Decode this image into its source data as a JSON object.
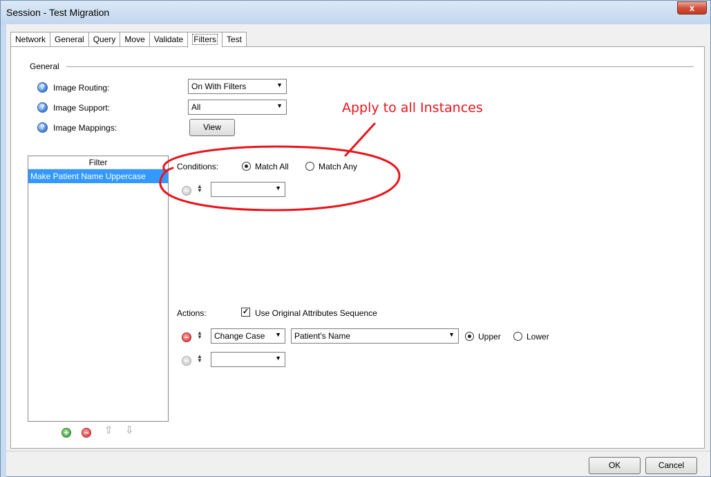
{
  "window": {
    "title": "Session - Test Migration",
    "close_label": "x"
  },
  "tabs": [
    {
      "label": "Network"
    },
    {
      "label": "General"
    },
    {
      "label": "Query"
    },
    {
      "label": "Move"
    },
    {
      "label": "Validate"
    },
    {
      "label": "Filters",
      "active": true
    },
    {
      "label": "Test"
    }
  ],
  "general": {
    "group_label": "General",
    "image_routing": {
      "label": "Image Routing:",
      "value": "On With Filters"
    },
    "image_support": {
      "label": "Image Support:",
      "value": "All"
    },
    "image_mappings": {
      "label": "Image Mappings:",
      "button": "View"
    }
  },
  "filter_list": {
    "header": "Filter",
    "items": [
      {
        "label": "Make Patient Name Uppercase",
        "selected": true
      }
    ]
  },
  "conditions": {
    "label": "Conditions:",
    "match_all": "Match All",
    "match_any": "Match Any",
    "selected": "Match All",
    "rows": [
      {
        "value": ""
      }
    ]
  },
  "actions": {
    "label": "Actions:",
    "use_original_label": "Use Original Attributes Sequence",
    "use_original_checked": true,
    "rows": [
      {
        "action": "Change Case",
        "attribute": "Patient's Name",
        "option_upper": "Upper",
        "option_lower": "Lower",
        "selected": "Upper"
      },
      {
        "action": ""
      }
    ]
  },
  "annotation": {
    "text": "Apply to all Instances",
    "color": "#e8141c"
  },
  "footer": {
    "ok": "OK",
    "cancel": "Cancel"
  }
}
